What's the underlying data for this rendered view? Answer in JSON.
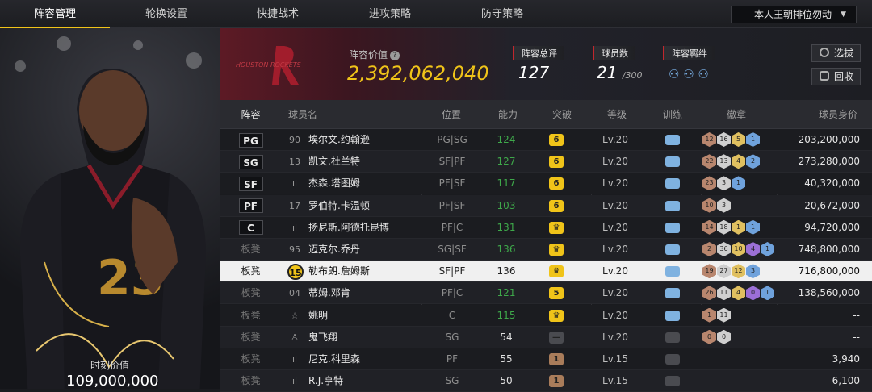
{
  "tabs": [
    "阵容管理",
    "轮换设置",
    "快捷战术",
    "进攻策略",
    "防守策略"
  ],
  "team_select": "本人王朝排位勿动",
  "card": {
    "label": "时刻价值",
    "value": "109,000,000"
  },
  "banner": {
    "logo_text": "HOUSTON ROCKETS",
    "value_label": "阵容价值",
    "value": "2,392,062,040",
    "overall_label": "阵容总评",
    "overall": "127",
    "count_label": "球员数",
    "count": "21",
    "count_max": "/300",
    "bond_label": "阵容羁绊",
    "select_label": "选拔",
    "recycle_label": "回收"
  },
  "headers": [
    "阵容",
    "球员名",
    "位置",
    "能力",
    "突破",
    "等级",
    "训练",
    "徽章",
    "球员身价"
  ],
  "colors": {
    "accent": "#f0c419",
    "green": "#3ea84a",
    "red": "#c1272d"
  },
  "players": [
    {
      "slot": "PG",
      "starter": true,
      "num": "90",
      "name": "埃尔文.约翰逊",
      "pos": "PG|SG",
      "rating": "124",
      "green": true,
      "break": "6",
      "break_type": "gold",
      "level": "Lv.20",
      "train": "blue",
      "badges": [
        {
          "t": "12",
          "c": "#b8866e"
        },
        {
          "t": "16",
          "c": "#cfcfcf"
        },
        {
          "t": "5",
          "c": "#e0c060"
        },
        {
          "t": "1",
          "c": "#6fa2dc"
        }
      ],
      "worth": "203,200,000"
    },
    {
      "slot": "SG",
      "starter": true,
      "num": "13",
      "name": "凯文.杜兰特",
      "pos": "SF|PF",
      "rating": "127",
      "green": true,
      "break": "6",
      "break_type": "gold",
      "level": "Lv.20",
      "train": "blue",
      "badges": [
        {
          "t": "22",
          "c": "#b8866e"
        },
        {
          "t": "13",
          "c": "#cfcfcf"
        },
        {
          "t": "4",
          "c": "#e0c060"
        },
        {
          "t": "2",
          "c": "#6fa2dc"
        }
      ],
      "worth": "273,280,000"
    },
    {
      "slot": "SF",
      "starter": true,
      "num": "ıl",
      "name": "杰森.塔图姆",
      "pos": "PF|SF",
      "rating": "117",
      "green": true,
      "break": "6",
      "break_type": "gold",
      "level": "Lv.20",
      "train": "blue",
      "badges": [
        {
          "t": "23",
          "c": "#b8866e"
        },
        {
          "t": "3",
          "c": "#cfcfcf"
        },
        {
          "t": "1",
          "c": "#6fa2dc"
        }
      ],
      "worth": "40,320,000"
    },
    {
      "slot": "PF",
      "starter": true,
      "num": "17",
      "name": "罗伯特.卡温顿",
      "pos": "PF|SF",
      "rating": "103",
      "green": true,
      "break": "6",
      "break_type": "gold",
      "level": "Lv.20",
      "train": "blue",
      "badges": [
        {
          "t": "10",
          "c": "#b8866e"
        },
        {
          "t": "3",
          "c": "#cfcfcf"
        }
      ],
      "worth": "20,672,000"
    },
    {
      "slot": "C",
      "starter": true,
      "num": "ıl",
      "name": "扬尼斯.阿德托昆博",
      "pos": "PF|C",
      "rating": "131",
      "green": true,
      "break": "♛",
      "break_type": "gold",
      "level": "Lv.20",
      "train": "blue",
      "badges": [
        {
          "t": "14",
          "c": "#b8866e"
        },
        {
          "t": "18",
          "c": "#cfcfcf"
        },
        {
          "t": "1",
          "c": "#e0c060"
        },
        {
          "t": "1",
          "c": "#6fa2dc"
        }
      ],
      "worth": "94,720,000"
    },
    {
      "slot": "板凳",
      "starter": false,
      "num": "95",
      "name": "迈克尔.乔丹",
      "pos": "SG|SF",
      "rating": "136",
      "green": true,
      "break": "♛",
      "break_type": "gold",
      "level": "Lv.20",
      "train": "blue",
      "badges": [
        {
          "t": "2",
          "c": "#b8866e"
        },
        {
          "t": "36",
          "c": "#cfcfcf"
        },
        {
          "t": "10",
          "c": "#e0c060"
        },
        {
          "t": "4",
          "c": "#9b6fd6"
        },
        {
          "t": "1",
          "c": "#6fa2dc"
        }
      ],
      "worth": "748,800,000"
    },
    {
      "slot": "板凳",
      "starter": false,
      "num": "15",
      "name": "勒布朗.詹姆斯",
      "pos": "SF|PF",
      "rating": "136",
      "green": false,
      "break": "♛",
      "break_type": "gold",
      "level": "Lv.20",
      "train": "blue",
      "badges": [
        {
          "t": "19",
          "c": "#b8866e"
        },
        {
          "t": "27",
          "c": "#cfcfcf"
        },
        {
          "t": "12",
          "c": "#e0c060"
        },
        {
          "t": "3",
          "c": "#6fa2dc"
        }
      ],
      "worth": "716,800,000",
      "selected": true
    },
    {
      "slot": "板凳",
      "starter": false,
      "num": "04",
      "name": "蒂姆.邓肯",
      "pos": "PF|C",
      "rating": "121",
      "green": true,
      "break": "5",
      "break_type": "gold",
      "level": "Lv.20",
      "train": "blue",
      "badges": [
        {
          "t": "26",
          "c": "#b8866e"
        },
        {
          "t": "11",
          "c": "#cfcfcf"
        },
        {
          "t": "4",
          "c": "#e0c060"
        },
        {
          "t": "0",
          "c": "#9b6fd6"
        },
        {
          "t": "1",
          "c": "#6fa2dc"
        }
      ],
      "worth": "138,560,000"
    },
    {
      "slot": "板凳",
      "starter": false,
      "num": "☆",
      "name": "姚明",
      "pos": "C",
      "rating": "115",
      "green": true,
      "break": "♛",
      "break_type": "gold",
      "level": "Lv.20",
      "train": "blue",
      "badges": [
        {
          "t": "1",
          "c": "#b8866e"
        },
        {
          "t": "11",
          "c": "#cfcfcf"
        }
      ],
      "worth": "--"
    },
    {
      "slot": "板凳",
      "starter": false,
      "num": "♙",
      "name": "鬼飞翔",
      "pos": "SG",
      "rating": "54",
      "green": false,
      "break": "—",
      "break_type": "gray",
      "level": "Lv.20",
      "train": "gray",
      "badges": [
        {
          "t": "0",
          "c": "#b8866e"
        },
        {
          "t": "0",
          "c": "#cfcfcf"
        }
      ],
      "worth": "--"
    },
    {
      "slot": "板凳",
      "starter": false,
      "num": "ıl",
      "name": "尼克.科里森",
      "pos": "PF",
      "rating": "55",
      "green": false,
      "break": "1",
      "break_type": "bronze",
      "level": "Lv.15",
      "train": "gray",
      "badges": [],
      "worth": "3,940"
    },
    {
      "slot": "板凳",
      "starter": false,
      "num": "ıl",
      "name": "R.J.亨特",
      "pos": "SG",
      "rating": "50",
      "green": false,
      "break": "1",
      "break_type": "bronze",
      "level": "Lv.15",
      "train": "gray",
      "badges": [],
      "worth": "6,100"
    }
  ]
}
